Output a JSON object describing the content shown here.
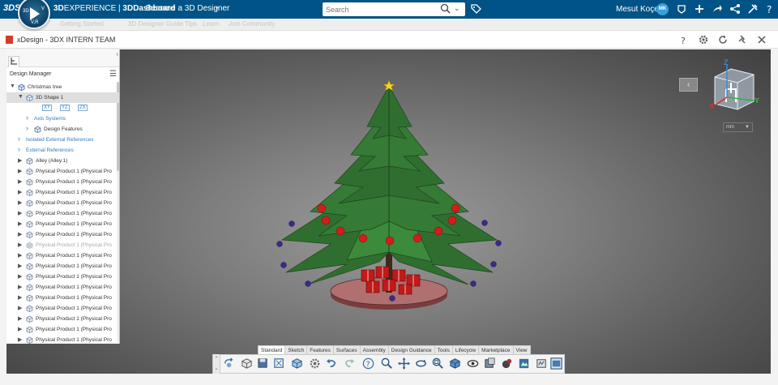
{
  "topbar": {
    "logo": "3DS",
    "brand_bold": "3D",
    "brand_rest": "EXPERIENCE | ",
    "brand_app": "3DDashboard",
    "dashboard_title": "Become a 3D Designer",
    "search_placeholder": "Search",
    "user_name": "Mesut Koçer",
    "user_initials": "MK",
    "compass_3d": "3D",
    "compass_v": "V",
    "compass_vr": "V,R"
  },
  "subbar": {
    "items": [
      "Getting Started",
      "3D Designer Guide Tips",
      "Learn",
      "Join Community"
    ]
  },
  "widget": {
    "title": "xDesign - 3DX INTERN TEAM"
  },
  "panel": {
    "title": "Design Manager",
    "tree": [
      {
        "label": "Christmas tree",
        "level": 0,
        "twisty": "▼",
        "icon": "product-icon",
        "type": "normal"
      },
      {
        "label": "3D Shape 1",
        "level": 1,
        "twisty": "▼",
        "icon": "shape-icon",
        "type": "selected"
      },
      {
        "label": "",
        "level": 2,
        "twisty": "",
        "icon": "planes-icon",
        "type": "planes"
      },
      {
        "label": "Axis Systems",
        "level": 2,
        "twisty": "›",
        "icon": "",
        "type": "link"
      },
      {
        "label": "Design Features",
        "level": 2,
        "twisty": "›",
        "icon": "feature-icon",
        "type": "normal"
      },
      {
        "label": "Isolated External References",
        "level": 1,
        "twisty": "›",
        "icon": "",
        "type": "link"
      },
      {
        "label": "External References",
        "level": 1,
        "twisty": "›",
        "icon": "",
        "type": "link"
      },
      {
        "label": "Alley (Alley.1)",
        "level": 1,
        "twisty": "▶",
        "icon": "assembly-icon",
        "type": "normal"
      },
      {
        "label": "Physical Product 1 (Physical Pro",
        "level": 1,
        "twisty": "▶",
        "icon": "physical-product-icon",
        "type": "normal"
      },
      {
        "label": "Physical Product 1 (Physical Pro",
        "level": 1,
        "twisty": "▶",
        "icon": "physical-product-icon",
        "type": "normal"
      },
      {
        "label": "Physical Product 1 (Physical Pro",
        "level": 1,
        "twisty": "▶",
        "icon": "physical-product-icon",
        "type": "normal"
      },
      {
        "label": "Physical Product 1 (Physical Pro",
        "level": 1,
        "twisty": "▶",
        "icon": "physical-product-icon",
        "type": "normal"
      },
      {
        "label": "Physical Product 1 (Physical Pro",
        "level": 1,
        "twisty": "▶",
        "icon": "physical-product-icon",
        "type": "normal"
      },
      {
        "label": "Physical Product 1 (Physical Pro",
        "level": 1,
        "twisty": "▶",
        "icon": "physical-product-icon",
        "type": "normal"
      },
      {
        "label": "Physical Product 1 (Physical Pro",
        "level": 1,
        "twisty": "▶",
        "icon": "physical-product-icon",
        "type": "normal"
      },
      {
        "label": "Physical Product 1 (Physical Pro",
        "level": 1,
        "twisty": "▶",
        "icon": "physical-product-icon",
        "type": "dim"
      },
      {
        "label": "Physical Product 1 (Physical Pro",
        "level": 1,
        "twisty": "▶",
        "icon": "physical-product-icon",
        "type": "normal"
      },
      {
        "label": "Physical Product 1 (Physical Pro",
        "level": 1,
        "twisty": "▶",
        "icon": "physical-product-icon",
        "type": "normal"
      },
      {
        "label": "Physical Product 1 (Physical Pro",
        "level": 1,
        "twisty": "▶",
        "icon": "physical-product-icon",
        "type": "normal"
      },
      {
        "label": "Physical Product 1 (Physical Pro",
        "level": 1,
        "twisty": "▶",
        "icon": "physical-product-icon",
        "type": "normal"
      },
      {
        "label": "Physical Product 1 (Physical Pro",
        "level": 1,
        "twisty": "▶",
        "icon": "physical-product-icon",
        "type": "normal"
      },
      {
        "label": "Physical Product 1 (Physical Pro",
        "level": 1,
        "twisty": "▶",
        "icon": "physical-product-icon",
        "type": "normal"
      },
      {
        "label": "Physical Product 1 (Physical Pro",
        "level": 1,
        "twisty": "▶",
        "icon": "physical-product-icon",
        "type": "normal"
      },
      {
        "label": "Physical Product 1 (Physical Pro",
        "level": 1,
        "twisty": "▶",
        "icon": "physical-product-icon",
        "type": "normal"
      },
      {
        "label": "Physical Product 1 (Physical Pro",
        "level": 1,
        "twisty": "▶",
        "icon": "physical-product-icon",
        "type": "normal"
      },
      {
        "label": "Physical Product 1 (Physical Pro",
        "level": 1,
        "twisty": "▶",
        "icon": "physical-product-icon",
        "type": "normal"
      }
    ],
    "planes": [
      "XY",
      "YZ",
      "ZX"
    ]
  },
  "viewport": {
    "unit": "mm",
    "axis_x": "X",
    "axis_y": "Y",
    "axis_z": "Z"
  },
  "actionbar": {
    "tabs": [
      "Standard",
      "Sketch",
      "Features",
      "Surfaces",
      "Assembly",
      "Design Guidance",
      "Tools",
      "Lifecycle",
      "Marketplace",
      "View"
    ],
    "active_tab": "Standard",
    "tools": [
      "undo-redo-icon",
      "box-icon",
      "save-icon",
      "fit-icon",
      "cube-icon",
      "settings-icon",
      "undo-icon",
      "redo-icon",
      "help-icon",
      "zoom-icon",
      "pan-icon",
      "rotate-icon",
      "zoom-area-icon",
      "view-cube-icon",
      "hide-show-icon",
      "section-icon",
      "material-icon",
      "render-icon",
      "measure-icon",
      "display-icon"
    ]
  },
  "colors": {
    "topbar": "#005386",
    "tree_green": "#2f6e2f",
    "ornament_red": "#d31d1d",
    "base_brown": "#9b5656",
    "link_blue": "#2e7bbd"
  }
}
